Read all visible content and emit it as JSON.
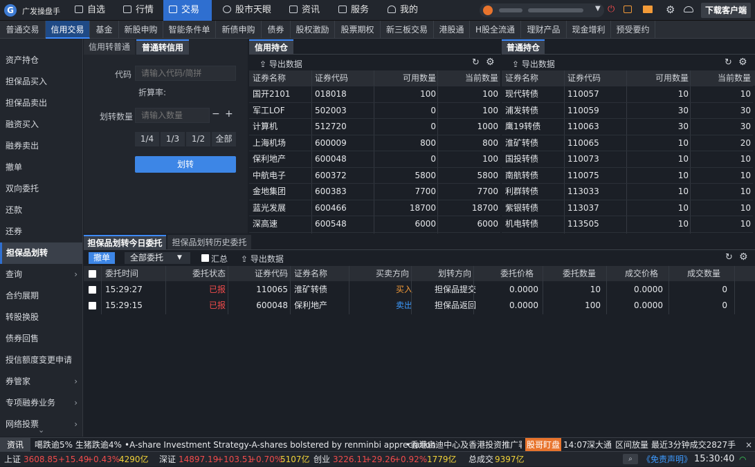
{
  "app": {
    "title": "广发操盘手",
    "logo": "G"
  },
  "topnav": [
    {
      "label": "自选",
      "icon": "plus-square-icon"
    },
    {
      "label": "行情",
      "icon": "chart-icon"
    },
    {
      "label": "交易",
      "icon": "hammer-icon"
    },
    {
      "label": "股市天眼",
      "icon": "eye-icon"
    },
    {
      "label": "资讯",
      "icon": "newspaper-icon"
    },
    {
      "label": "服务",
      "icon": "briefcase-icon"
    },
    {
      "label": "我的",
      "icon": "user-icon"
    }
  ],
  "download_label": "下载客户端",
  "tabs": [
    "普通交易",
    "信用交易",
    "基金",
    "新股申购",
    "智能条件单",
    "新债申购",
    "债券",
    "股权激励",
    "股票期权",
    "新三板交易",
    "港股通",
    "H股全流通",
    "理财产品",
    "现金增利",
    "预受要约"
  ],
  "sidebar": [
    "资产持仓",
    "担保品买入",
    "担保品卖出",
    "融资买入",
    "融券卖出",
    "撤单",
    "双向委托",
    "还款",
    "还券",
    "担保品划转",
    "查询",
    "合约展期",
    "转股换股",
    "债券回售",
    "授信额度变更申请",
    "券管家",
    "专项融券业务",
    "网络投票"
  ],
  "transfer": {
    "tab_a": "信用转普通",
    "tab_b": "普通转信用",
    "code_label": "代码",
    "code_placeholder": "请输入代码/简拼",
    "discount_label": "折算率:",
    "qty_label": "划转数量",
    "qty_placeholder": "请输入数量",
    "minus": "−",
    "plus": "+",
    "fractions": [
      "1/4",
      "1/3",
      "1/2",
      "全部"
    ],
    "submit": "划转"
  },
  "credit": {
    "title": "信用持仓",
    "export": "导出数据",
    "columns": [
      "证券名称",
      "证券代码",
      "可用数量",
      "当前数量"
    ],
    "rows": [
      [
        "国开2101",
        "018018",
        "100",
        "100"
      ],
      [
        "军工LOF",
        "502003",
        "0",
        "100"
      ],
      [
        "计算机",
        "512720",
        "0",
        "1000"
      ],
      [
        "上海机场",
        "600009",
        "800",
        "800"
      ],
      [
        "保利地产",
        "600048",
        "0",
        "100"
      ],
      [
        "中航电子",
        "600372",
        "5800",
        "5800"
      ],
      [
        "金地集团",
        "600383",
        "7700",
        "7700"
      ],
      [
        "蓝光发展",
        "600466",
        "18700",
        "18700"
      ],
      [
        "深高速",
        "600548",
        "6000",
        "6000"
      ]
    ]
  },
  "normal": {
    "title": "普通持仓",
    "export": "导出数据",
    "columns": [
      "证券名称",
      "证券代码",
      "可用数量",
      "当前数量"
    ],
    "rows": [
      [
        "现代转债",
        "110057",
        "10",
        "10"
      ],
      [
        "浦发转债",
        "110059",
        "30",
        "30"
      ],
      [
        "鹰19转债",
        "110063",
        "30",
        "30"
      ],
      [
        "淮矿转债",
        "110065",
        "10",
        "20"
      ],
      [
        "国投转债",
        "110073",
        "10",
        "10"
      ],
      [
        "南航转债",
        "110075",
        "10",
        "10"
      ],
      [
        "利群转债",
        "113033",
        "10",
        "10"
      ],
      [
        "紫银转债",
        "113037",
        "10",
        "10"
      ],
      [
        "机电转债",
        "113505",
        "10",
        "10"
      ]
    ]
  },
  "orders": {
    "tab_today": "担保品划转今日委托",
    "tab_history": "担保品划转历史委托",
    "cancel": "撤单",
    "filter": "全部委托",
    "summary": "汇总",
    "export": "导出数据",
    "columns": [
      "委托时间",
      "委托状态",
      "证券代码",
      "证券名称",
      "买卖方向",
      "划转方向",
      "委托价格",
      "委托数量",
      "成交价格",
      "成交数量"
    ],
    "rows": [
      {
        "time": "15:29:27",
        "status": "已报",
        "code": "110065",
        "name": "淮矿转债",
        "side": "买入",
        "dir": "担保品提交",
        "price": "0.0000",
        "qty": "10",
        "fill_price": "0.0000",
        "fill_qty": "0"
      },
      {
        "time": "15:29:15",
        "status": "已报",
        "code": "600048",
        "name": "保利地产",
        "side": "卖出",
        "dir": "担保品返回",
        "price": "0.0000",
        "qty": "100",
        "fill_price": "0.0000",
        "fill_qty": "0"
      }
    ]
  },
  "ticker": {
    "label": "资讯",
    "news1": "噶跌逾5% 生猪跌逾4%",
    "news2": "•A-share Investment Strategy-A-shares bolstered by renminbi appreciation",
    "news3": "•香港启迪中心及香港投资推广署",
    "badge": "股哥盯盘",
    "time": "14:07",
    "item1": "深大通",
    "item2": "区间放量",
    "item3": "最近3分钟成交2827手"
  },
  "status": {
    "sh_label": "上证",
    "sh_val": "3608.85",
    "sh_chg": "+15.49",
    "sh_pct": "+0.43%",
    "sh_amt": "4290亿",
    "sz_label": "深证",
    "sz_val": "14897.19",
    "sz_chg": "+103.51",
    "sz_pct": "+0.70%",
    "sz_amt": "5107亿",
    "cy_label": "创业",
    "cy_val": "3226.11",
    "cy_chg": "+29.26",
    "cy_pct": "+0.92%",
    "cy_amt": "1779亿",
    "total_label": "总成交",
    "total_amt": "9397亿",
    "disclaimer": "《免责声明》",
    "clock": "15:30:40"
  },
  "colors": {
    "accent": "#2f6fd0",
    "red": "#f24b4b",
    "orange": "#f29a38",
    "blue": "#3d9bff",
    "yellow": "#f2d338"
  }
}
